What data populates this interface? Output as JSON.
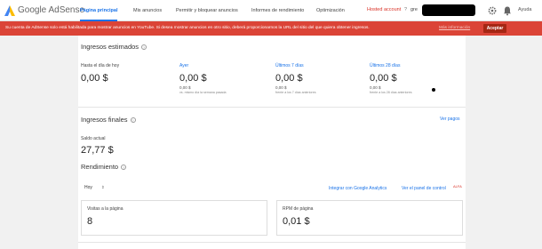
{
  "app": {
    "name": "Google AdSense"
  },
  "nav": [
    {
      "label": "Página principal",
      "active": true
    },
    {
      "label": "Mis anuncios"
    },
    {
      "label": "Permitir y bloquear anuncios"
    },
    {
      "label": "Informes de rendimiento"
    },
    {
      "label": "Optimización"
    }
  ],
  "header": {
    "hosted_account": "Hosted account",
    "question_mark": "?",
    "account_prefix": "gre",
    "help": "Ayuda"
  },
  "alert": {
    "text": "Su cuenta de AdSense solo está habilitada para mostrar anuncios en YouTube. Si desea mostrar anuncios en otro sitio, deberá proporcionarnos la URL del sitio del que quiera obtener ingresos.",
    "link": "Más información",
    "button": "Aceptar",
    "color": "#db4437"
  },
  "estimated": {
    "title": "Ingresos estimados",
    "today": {
      "label": "Hasta el día de hoy",
      "value": "0,00 $"
    },
    "yesterday": {
      "label": "Ayer",
      "value": "0,00 $",
      "sub": "0,00 $",
      "note": "vs. mismo día la semana pasada"
    },
    "last7": {
      "label": "Últimos 7 días",
      "value": "0,00 $",
      "sub": "0,00 $",
      "note": "frente a los 7 días anteriores"
    },
    "last28": {
      "label": "Últimos 28 días",
      "value": "0,00 $",
      "sub": "0,00 $",
      "note": "frente a los 28 días anteriores"
    }
  },
  "final": {
    "title": "Ingresos finales",
    "link": "Ver pagos",
    "balance_label": "Saldo actual",
    "balance": "27,77 $"
  },
  "performance": {
    "title": "Rendimiento",
    "period": "Hoy",
    "analytics_link": "Integrar con Google Analytics",
    "control_link": "Ver el panel de control",
    "badge": "ALFA",
    "cards": [
      {
        "label": "Visitas a la página",
        "value": "8"
      },
      {
        "label": "RPM de página",
        "value": "0,01 $"
      }
    ]
  },
  "colors": {
    "accent": "#1a73e8",
    "alert": "#db4437"
  }
}
